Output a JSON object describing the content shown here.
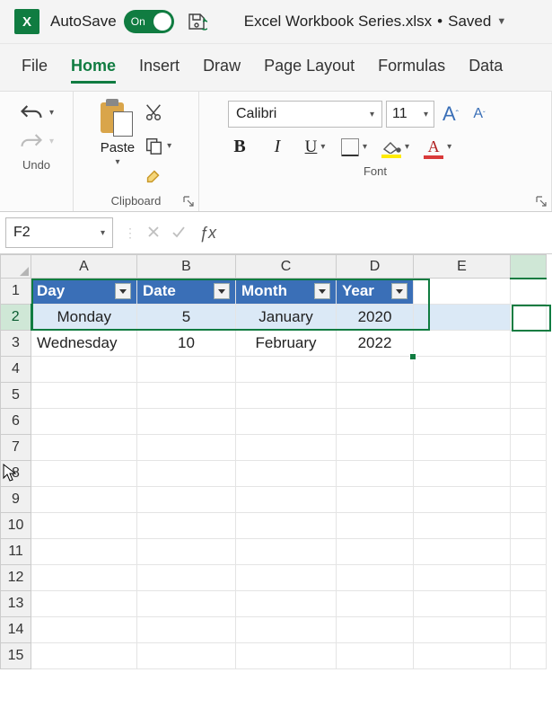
{
  "titlebar": {
    "autosave_label": "AutoSave",
    "toggle_state": "On",
    "doc_name": "Excel Workbook Series.xlsx",
    "doc_status": "Saved"
  },
  "tabs": [
    "File",
    "Home",
    "Insert",
    "Draw",
    "Page Layout",
    "Formulas",
    "Data"
  ],
  "active_tab": "Home",
  "ribbon": {
    "undo_group": "Undo",
    "clipboard_group": "Clipboard",
    "paste_label": "Paste",
    "font_group": "Font",
    "font_name": "Calibri",
    "font_size": "11",
    "bold": "B",
    "italic": "I",
    "underline": "U",
    "grow_font": "A",
    "shrink_font": "A",
    "font_color_letter": "A"
  },
  "namebox": "F2",
  "formula_value": "",
  "columns": [
    "A",
    "B",
    "C",
    "D",
    "E"
  ],
  "row_numbers": [
    "1",
    "2",
    "3",
    "4",
    "5",
    "6",
    "7",
    "8",
    "9",
    "10",
    "11",
    "12",
    "13",
    "14",
    "15"
  ],
  "table": {
    "headers": [
      "Day",
      "Date",
      "Month",
      "Year"
    ],
    "rows": [
      {
        "day": "Monday",
        "date": "5",
        "month": "January",
        "year": "2020"
      },
      {
        "day": "Wednesday",
        "date": "10",
        "month": "February",
        "year": "2022"
      }
    ]
  },
  "chart_data": {
    "type": "table",
    "title": "",
    "columns": [
      "Day",
      "Date",
      "Month",
      "Year"
    ],
    "rows": [
      [
        "Monday",
        5,
        "January",
        2020
      ],
      [
        "Wednesday",
        10,
        "February",
        2022
      ]
    ]
  }
}
